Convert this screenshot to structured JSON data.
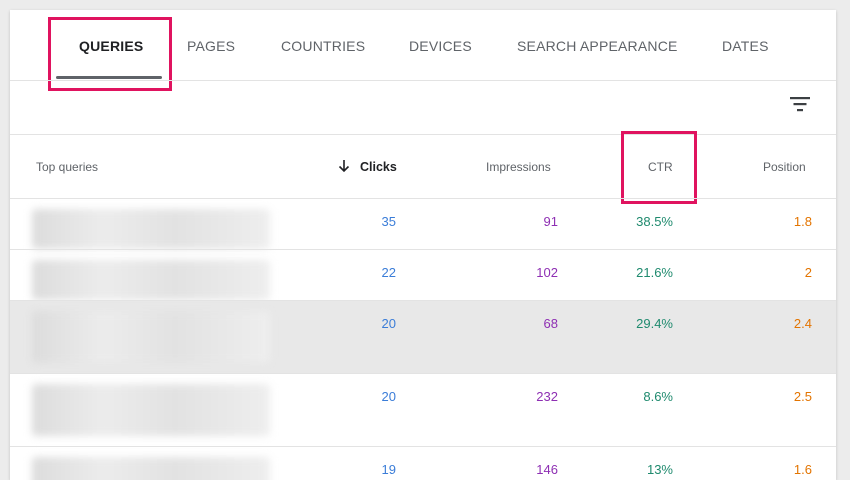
{
  "tabs": [
    {
      "label": "QUERIES",
      "active": true
    },
    {
      "label": "PAGES",
      "active": false
    },
    {
      "label": "COUNTRIES",
      "active": false
    },
    {
      "label": "DEVICES",
      "active": false
    },
    {
      "label": "SEARCH APPEARANCE",
      "active": false
    },
    {
      "label": "DATES",
      "active": false
    }
  ],
  "toolbar": {
    "filter_icon": "filter-icon"
  },
  "table": {
    "headers": {
      "query": "Top queries",
      "clicks": "Clicks",
      "impressions": "Impressions",
      "ctr": "CTR",
      "position": "Position"
    },
    "sort_column": "clicks",
    "sort_direction": "descending",
    "rows": [
      {
        "clicks": "35",
        "impressions": "91",
        "ctr": "38.5%",
        "position": "1.8"
      },
      {
        "clicks": "22",
        "impressions": "102",
        "ctr": "21.6%",
        "position": "2"
      },
      {
        "clicks": "20",
        "impressions": "68",
        "ctr": "29.4%",
        "position": "2.4"
      },
      {
        "clicks": "20",
        "impressions": "232",
        "ctr": "8.6%",
        "position": "2.5"
      },
      {
        "clicks": "19",
        "impressions": "146",
        "ctr": "13%",
        "position": "1.6"
      }
    ]
  },
  "colors": {
    "highlight": "#e0135f",
    "clicks": "#3b7dd8",
    "impressions": "#8e2fb3",
    "ctr": "#1f8a6e",
    "position": "#e37400"
  }
}
